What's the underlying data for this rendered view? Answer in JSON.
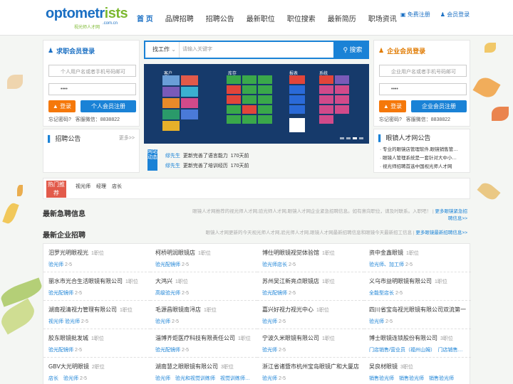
{
  "header": {
    "logo": {
      "word1": "optometr",
      "word2": "ists",
      "sub": "视光师人才网",
      "domain": ".com.cn"
    },
    "nav": [
      "首 页",
      "品牌招聘",
      "招聘公告",
      "最新职位",
      "职位搜索",
      "最新简历",
      "职场资讯"
    ],
    "register": "免费注册",
    "login": "会员登录"
  },
  "job_seeker": {
    "title": "求职会员登录",
    "user_placeholder": "个人用户名或者手机号码邮可",
    "pwd": "••••",
    "login_btn": "登录",
    "register_btn": "个人会员注册",
    "forgot": "忘记密码?",
    "phone": "客服微信：8838822",
    "notice_title": "招聘公告",
    "more": "更多>>"
  },
  "search": {
    "category": "找工作",
    "placeholder": "请输入关键字",
    "button": "搜索"
  },
  "banner": {
    "labels": [
      "客户",
      "库存",
      "报表",
      "系统"
    ]
  },
  "site_news": {
    "tag": "网站动态",
    "items": [
      {
        "user": "缪先生",
        "text": "更新完善了语言能力",
        "time": "170天前"
      },
      {
        "user": "缪先生",
        "text": "更新完善了培训经历",
        "time": "170天前"
      }
    ]
  },
  "employer": {
    "title": "企业会员登录",
    "user_placeholder": "企业用户名或者手机号码邮可",
    "pwd": "••••",
    "login_btn": "登录",
    "register_btn": "企业会员注册",
    "forgot": "忘记密码?",
    "phone": "客服微信：8838822",
    "notice_title": "眼镜人才网公告",
    "notices": [
      "专业的眼镜店管理软件,眼镜销售管…",
      "眼镜人管理系统是一套针对大中小…",
      "视光师招聘首选中国视光师人才网"
    ]
  },
  "hot": {
    "tag": "热门推荐",
    "keywords": [
      "视光师",
      "经理",
      "店长"
    ]
  },
  "urgent": {
    "title": "最新急聘信息",
    "desc": "眼镜人才网推荐的视光师人才网,验光师人才网,眼镜人才网企业紧急招聘信息。如有意向职位，请及时联系。入职吧！",
    "link": "更多眼镜紧急招聘信息>>"
  },
  "latest": {
    "title": "最新企业招聘",
    "desc": "眼镜人才网更新的今天视光师人才网,验光师人才网,眼镜人才网最新招聘信息和眼镜今天最新招工信息",
    "link": "更多眼镜最新招聘信息>>"
  },
  "companies": [
    {
      "name": "汨罗光明眼视光",
      "count": "1职位",
      "jobs": "验光师",
      "n": "2-5"
    },
    {
      "name": "柯桥明润眼镜店",
      "count": "1职位",
      "jobs": "验光配镜师",
      "n": "2-5"
    },
    {
      "name": "博仕明眼镜视觉体验馆",
      "count": "1职位",
      "jobs": "验光师店长",
      "n": "2-5"
    },
    {
      "name": "资中金鑫眼镜",
      "count": "1职位",
      "jobs": "验光师、加工师",
      "n": "2-5"
    },
    {
      "name": "丽水市光合生活眼镜有限公司",
      "count": "1职位",
      "jobs": "验光配镜师",
      "n": "2-5"
    },
    {
      "name": "大鸿兴",
      "count": "1职位",
      "jobs": "高级验光师",
      "n": "2-5"
    },
    {
      "name": "苏州吴江新亮点眼镜店",
      "count": "1职位",
      "jobs": "验光配镜师",
      "n": "2-5"
    },
    {
      "name": "义乌市益明眼镜有限公司",
      "count": "1职位",
      "jobs": "全能型店长",
      "n": "2-5"
    },
    {
      "name": "湖南视清视力管理有限公司",
      "count": "1职位",
      "jobs": "视光师 验光师",
      "n": "2-5"
    },
    {
      "name": "毛源昌眼镜南浔店",
      "count": "1职位",
      "jobs": "验光师",
      "n": "2-5"
    },
    {
      "name": "嘉兴好视力视光中心",
      "count": "1职位",
      "jobs": "验光师",
      "n": "2-5"
    },
    {
      "name": "四川省宝岛视光眼镜有限公司双流第一",
      "count": "",
      "jobs": "验光师",
      "n": "2-5"
    },
    {
      "name": "胶东眼镜批发城",
      "count": "1职位",
      "jobs": "验光配镜师",
      "n": "2-5"
    },
    {
      "name": "淄博齐炬医疗科技有限责任公司",
      "count": "1职位",
      "jobs": "验光配镜师",
      "n": "2-5"
    },
    {
      "name": "宁波久米眼镜有限公司",
      "count": "1职位",
      "jobs": "验光师",
      "n": "2-5"
    },
    {
      "name": "博士眼镜连锁股份有限公司",
      "count": "3职位",
      "jobs": "门店销售/营业员（福州山姆）　门店销售…",
      "n": ""
    },
    {
      "name": "GBV大光明眼镜",
      "count": "2职位",
      "jobs": "店长　验光师",
      "n": "2-5"
    },
    {
      "name": "湖南慧之眼眼镜有限公司",
      "count": "3职位",
      "jobs": "验光师　验光和视觉训练师　视觉训练师…",
      "n": ""
    },
    {
      "name": "浙江省诸暨市杭州宝岛眼镜广和大厦店",
      "count": "",
      "jobs": "验光师",
      "n": "2-5"
    },
    {
      "name": "吴良材眼镜",
      "count": "3职位",
      "jobs": "销售验光师　销售验光师　销售验光师",
      "n": ""
    }
  ],
  "colors": {
    "brand": "#1a82d6",
    "accent": "#f5780a",
    "hot": "#e25a4a"
  }
}
